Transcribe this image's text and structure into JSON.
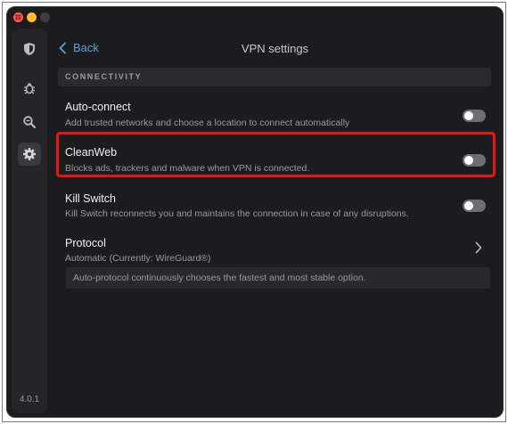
{
  "app": {
    "version": "4.0.1"
  },
  "sidebar": {
    "items": [
      {
        "icon": "shield-icon"
      },
      {
        "icon": "bug-icon"
      },
      {
        "icon": "search-icon"
      },
      {
        "icon": "gear-icon"
      }
    ]
  },
  "header": {
    "back_label": "Back",
    "title": "VPN settings"
  },
  "section": {
    "title": "CONNECTIVITY"
  },
  "settings": [
    {
      "title": "Auto-connect",
      "description": "Add trusted networks and choose a location to connect automatically",
      "enabled": false
    },
    {
      "title": "CleanWeb",
      "description": "Blocks ads, trackers and malware when VPN is connected.",
      "enabled": false
    },
    {
      "title": "Kill Switch",
      "description": "Kill Switch reconnects you and maintains the connection in case of any disruptions.",
      "enabled": false
    }
  ],
  "protocol": {
    "title": "Protocol",
    "value": "Automatic (Currently: WireGuard®)",
    "info": "Auto-protocol continuously chooses the fastest and most stable option."
  },
  "colors": {
    "accent": "#53a5d8",
    "highlight": "#e8141b",
    "background": "#1c1c1e"
  }
}
